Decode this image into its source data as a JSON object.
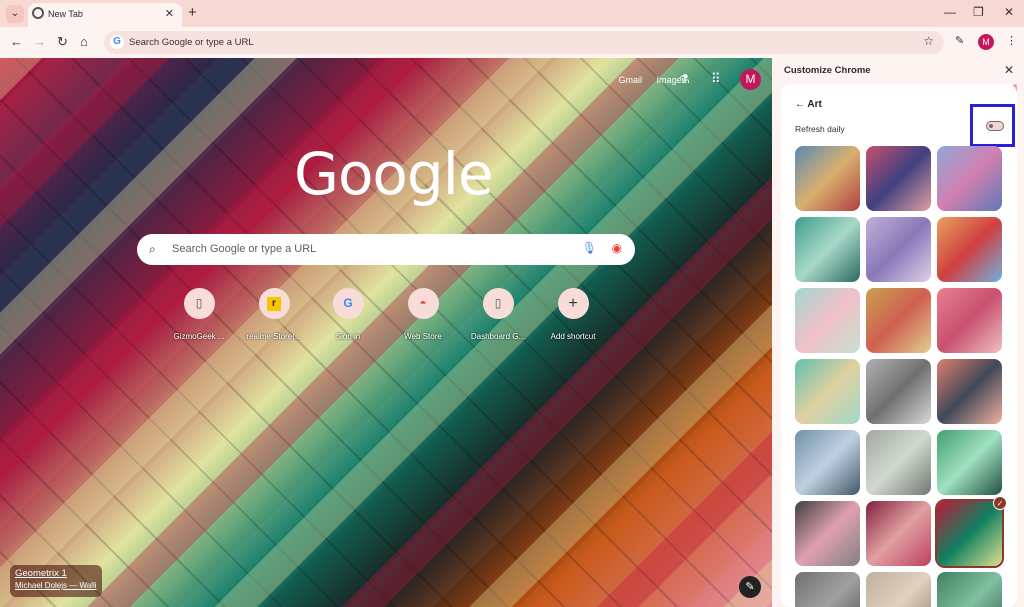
{
  "browser": {
    "tab_title": "New Tab",
    "omnibox_placeholder": "Search Google or type a URL"
  },
  "ntp": {
    "links": [
      "Gmail",
      "Images"
    ],
    "avatar_letter": "M",
    "logo_text": "Google",
    "search_placeholder": "Search Google or type a URL",
    "shortcuts": [
      {
        "label": "GizmoGeek ...",
        "icon": "page-icon"
      },
      {
        "label": "realme Store(...",
        "icon": "realme-icon"
      },
      {
        "label": "Sign in",
        "icon": "google-icon"
      },
      {
        "label": "Web Store",
        "icon": "webstore-icon"
      },
      {
        "label": "Dashboard G...",
        "icon": "page-icon"
      },
      {
        "label": "Add shortcut",
        "icon": "plus-icon"
      }
    ],
    "attribution": {
      "title": "Geometrix 1",
      "author": "Michael Dolejs — Walli"
    }
  },
  "panel": {
    "title": "Customize Chrome",
    "section": "Art",
    "refresh_label": "Refresh daily",
    "refresh_daily_on": false,
    "thumbnails": [
      {
        "name": "art-thumb-1",
        "colors": [
          "#5a8ab0",
          "#d8b070",
          "#b04040"
        ],
        "selected": false
      },
      {
        "name": "art-thumb-2",
        "colors": [
          "#c85070",
          "#404080",
          "#e0a0a0"
        ],
        "selected": false
      },
      {
        "name": "art-thumb-3",
        "colors": [
          "#8fa8d8",
          "#d080b0",
          "#6078b8"
        ],
        "selected": false
      },
      {
        "name": "art-thumb-4",
        "colors": [
          "#3f9e8c",
          "#a8d8c8",
          "#2a6a60"
        ],
        "selected": false
      },
      {
        "name": "art-thumb-5",
        "colors": [
          "#c0b0d8",
          "#8878b8",
          "#e0d0e8"
        ],
        "selected": false
      },
      {
        "name": "art-thumb-6",
        "colors": [
          "#e8a060",
          "#d04040",
          "#70b0e0"
        ],
        "selected": false
      },
      {
        "name": "art-thumb-7",
        "colors": [
          "#a0d8d0",
          "#f0c0c8",
          "#c8e0d0"
        ],
        "selected": false
      },
      {
        "name": "art-thumb-8",
        "colors": [
          "#c8a050",
          "#d06050",
          "#e0d090"
        ],
        "selected": false
      },
      {
        "name": "art-thumb-9",
        "colors": [
          "#e88090",
          "#c85070",
          "#f0c0c0"
        ],
        "selected": false
      },
      {
        "name": "art-thumb-10",
        "colors": [
          "#60c0b0",
          "#e0d0a0",
          "#a0d8c8"
        ],
        "selected": false
      },
      {
        "name": "art-thumb-11",
        "colors": [
          "#b0b0b0",
          "#707070",
          "#d8d8d8"
        ],
        "selected": false
      },
      {
        "name": "art-thumb-12",
        "colors": [
          "#e08070",
          "#404858",
          "#f0b0a0"
        ],
        "selected": false
      },
      {
        "name": "art-thumb-13",
        "colors": [
          "#7090a8",
          "#c0d0e0",
          "#405868"
        ],
        "selected": false
      },
      {
        "name": "art-thumb-14",
        "colors": [
          "#a0a8a0",
          "#d0d8d0",
          "#707870"
        ],
        "selected": false
      },
      {
        "name": "art-thumb-15",
        "colors": [
          "#40a070",
          "#a0e0c0",
          "#205040"
        ],
        "selected": false
      },
      {
        "name": "art-thumb-16",
        "colors": [
          "#404040",
          "#e0a0b0",
          "#808080"
        ],
        "selected": false
      },
      {
        "name": "art-thumb-17",
        "colors": [
          "#802040",
          "#e0a0a0",
          "#c04060"
        ],
        "selected": false
      },
      {
        "name": "art-thumb-18",
        "colors": [
          "#c01838",
          "#108060",
          "#e0e090"
        ],
        "selected": true
      },
      {
        "name": "art-thumb-19",
        "colors": [
          "#707070",
          "#a0a0a0",
          "#505050"
        ],
        "selected": false
      },
      {
        "name": "art-thumb-20",
        "colors": [
          "#c0b0a0",
          "#e0d0c0",
          "#908070"
        ],
        "selected": false
      },
      {
        "name": "art-thumb-21",
        "colors": [
          "#408060",
          "#80c0a0",
          "#306050"
        ],
        "selected": false
      }
    ]
  },
  "colors": {
    "accent": "#c2185b",
    "highlight_box": "#2a1ed6"
  }
}
